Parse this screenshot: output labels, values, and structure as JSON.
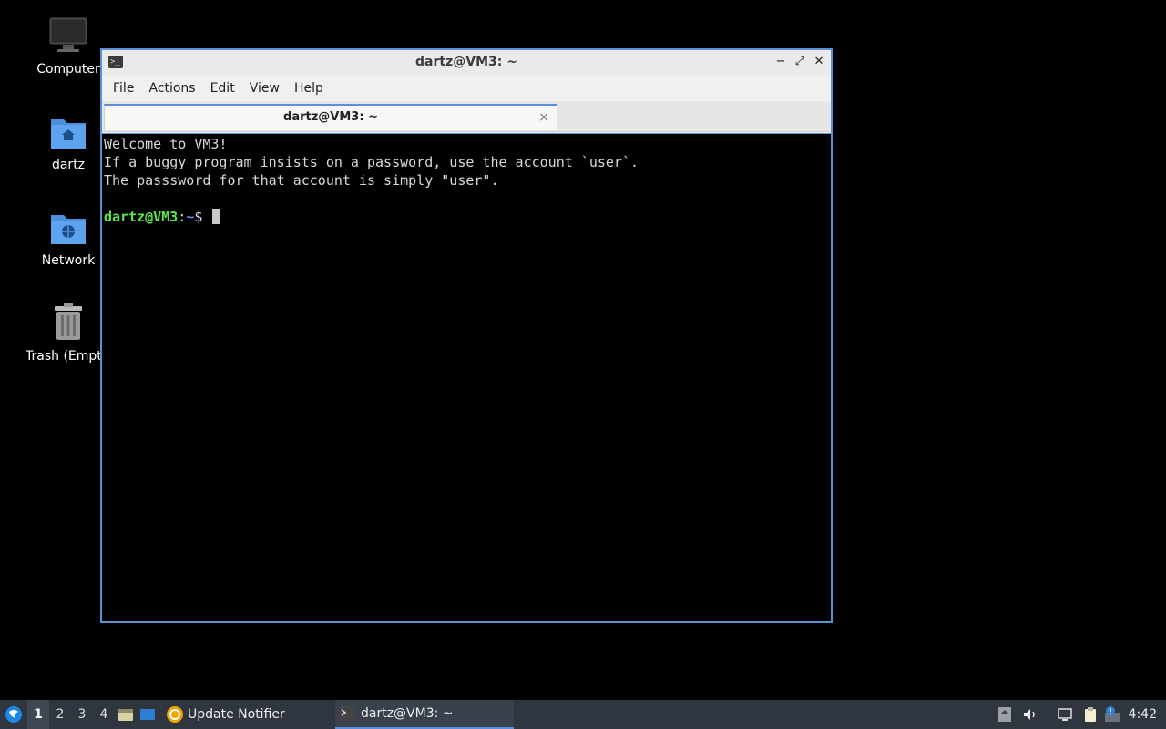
{
  "desktop": {
    "icons": [
      {
        "label": "Computer",
        "icon": "computer-icon"
      },
      {
        "label": "dartz",
        "icon": "home-folder-icon"
      },
      {
        "label": "Network",
        "icon": "network-folder-icon"
      },
      {
        "label": "Trash (Empty)",
        "icon": "trash-icon"
      }
    ]
  },
  "window": {
    "title": "dartz@VM3: ~",
    "menu": [
      "File",
      "Actions",
      "Edit",
      "View",
      "Help"
    ],
    "tab": {
      "label": "dartz@VM3: ~",
      "close": "×"
    },
    "controls": {
      "minimize": "−",
      "maximize": "⤢",
      "close": "✕"
    }
  },
  "terminal": {
    "lines": [
      "Welcome to VM3!",
      "If a buggy program insists on a password, use the account `user`.",
      "The passsword for that account is simply \"user\".",
      ""
    ],
    "prompt": {
      "user_host": "dartz@VM3",
      "colon": ":",
      "path": "~",
      "symbol": "$ "
    }
  },
  "taskbar": {
    "workspaces": [
      "1",
      "2",
      "3",
      "4"
    ],
    "active_workspace": "1",
    "tasks": [
      {
        "label": "Update Notifier",
        "icon": "update-notifier-icon"
      },
      {
        "label": "dartz@VM3: ~",
        "icon": "terminal-icon"
      }
    ],
    "clock": "4:42"
  }
}
